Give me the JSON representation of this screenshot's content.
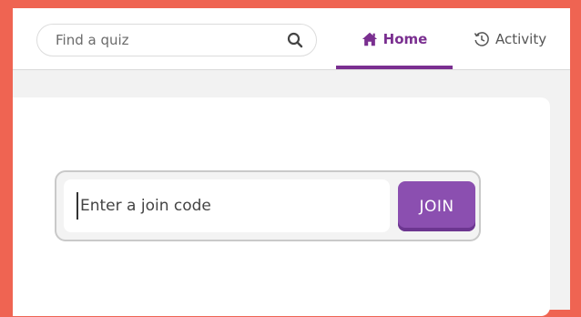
{
  "header": {
    "search": {
      "placeholder": "Find a quiz",
      "icon": "search-icon"
    },
    "tabs": [
      {
        "label": "Home",
        "icon": "home-icon",
        "active": true
      },
      {
        "label": "Activity",
        "icon": "history-icon",
        "active": false
      }
    ]
  },
  "join": {
    "placeholder": "Enter a join code",
    "button_label": "JOIN"
  },
  "colors": {
    "frame": "#ef6452",
    "accent": "#7a2f90",
    "join_button": "#8b4fb0"
  }
}
